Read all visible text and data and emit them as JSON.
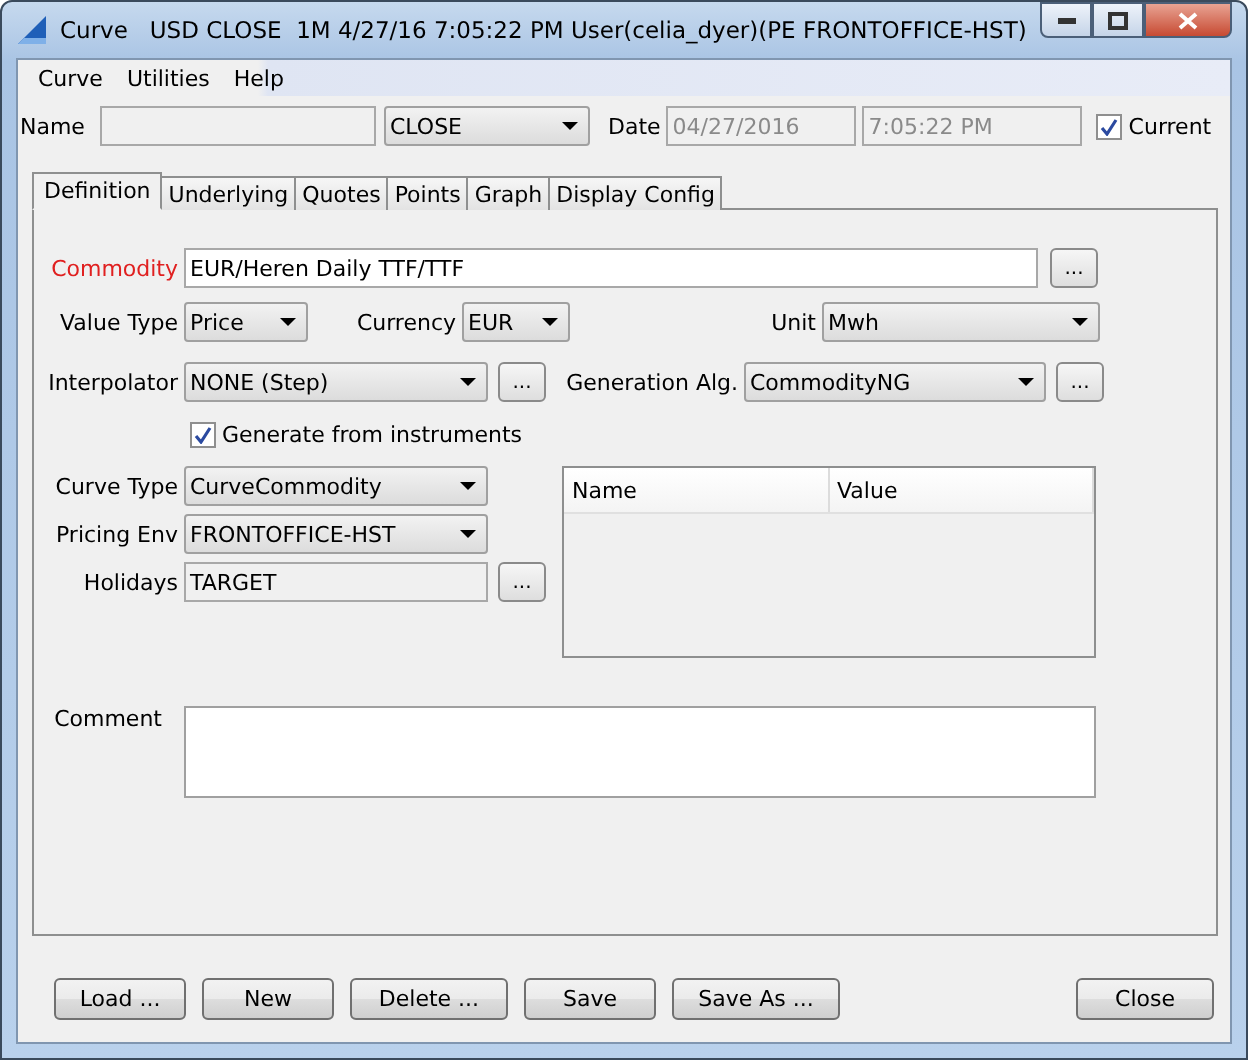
{
  "window": {
    "title": "Curve   USD CLOSE  1M 4/27/16 7:05:22 PM User(celia_dyer)(PE FRONTOFFICE-HST)"
  },
  "menu": [
    "Curve",
    "Utilities",
    "Help"
  ],
  "header": {
    "name_label": "Name",
    "type_value": "CLOSE",
    "date_label": "Date",
    "date_value": "04/27/2016",
    "time_value": "7:05:22 PM",
    "current": {
      "label": "Current",
      "checked": true
    }
  },
  "tabs": [
    {
      "label": "Definition",
      "selected": true
    },
    {
      "label": "Underlying",
      "selected": false
    },
    {
      "label": "Quotes",
      "selected": false
    },
    {
      "label": "Points",
      "selected": false
    },
    {
      "label": "Graph",
      "selected": false
    },
    {
      "label": "Display Config",
      "selected": false
    }
  ],
  "definition": {
    "commodity": {
      "label": "Commodity",
      "required": true,
      "value": "EUR/Heren Daily TTF/TTF",
      "button": "..."
    },
    "value_type": {
      "label": "Value Type",
      "value": "Price"
    },
    "currency": {
      "label": "Currency",
      "value": "EUR"
    },
    "unit": {
      "label": "Unit",
      "value": "Mwh"
    },
    "interpolator": {
      "label": "Interpolator",
      "value": "NONE (Step)",
      "button": "..."
    },
    "generation_alg": {
      "label": "Generation Alg.",
      "value": "CommodityNG",
      "button": "..."
    },
    "generate_from_instruments": {
      "label": "Generate from instruments",
      "checked": true
    },
    "curve_type": {
      "label": "Curve Type",
      "value": "CurveCommodity"
    },
    "pricing_env": {
      "label": "Pricing Env",
      "value": "FRONTOFFICE-HST"
    },
    "holidays": {
      "label": "Holidays",
      "value": "TARGET",
      "button": "..."
    },
    "params_table": {
      "columns": [
        "Name",
        "Value"
      ]
    },
    "comment": {
      "label": "Comment"
    }
  },
  "left_buttons": [
    "Load ...",
    "New",
    "Delete ...",
    "Save",
    "Save As ..."
  ],
  "right_buttons": [
    "Close"
  ]
}
